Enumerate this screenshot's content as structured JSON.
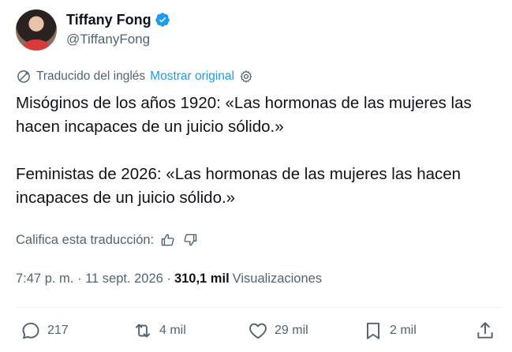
{
  "author": {
    "name": "Tiffany Fong",
    "handle": "@TiffanyFong",
    "verified_icon": "verified-badge-icon",
    "accent_color": "#1d9bf0"
  },
  "translation": {
    "label": "Traducido del inglés",
    "show_original": "Mostrar original",
    "icon": "translate-icon",
    "settings_icon": "gear-icon"
  },
  "tweet": {
    "paragraph_1": "Misóginos de los años 1920: «Las hormonas de las mujeres las hacen incapaces de un juicio sólido.»",
    "paragraph_2": "Feministas de 2026: «Las hormonas de las mujeres las hacen incapaces de un juicio sólido.»"
  },
  "rating": {
    "label": "Califica esta traducción:",
    "up_icon": "thumbs-up-icon",
    "down_icon": "thumbs-down-icon"
  },
  "meta": {
    "time": "7:47 p. m.",
    "separator": "·",
    "date": "11 sept. 2026",
    "views_count": "310,1 mil",
    "views_label": "Visualizaciones"
  },
  "actions": {
    "replies": "217",
    "retweets": "4 mil",
    "likes": "29 mil",
    "bookmarks": "2 mil"
  }
}
